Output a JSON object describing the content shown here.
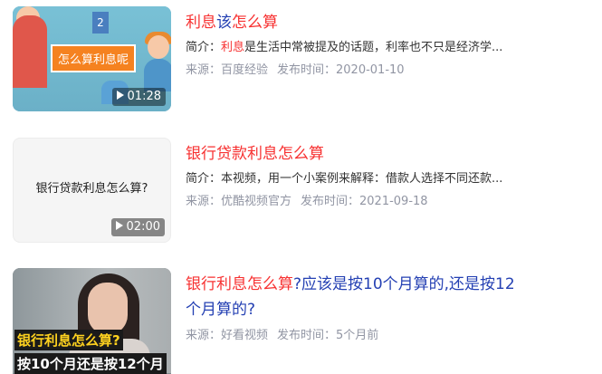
{
  "results": [
    {
      "thumb_sign": "怎么算利息呢",
      "thumb_flag": "2",
      "duration": "01:28",
      "title_parts": [
        {
          "text": "利息",
          "hl": true
        },
        {
          "text": "该",
          "hl": false
        },
        {
          "text": "怎么算",
          "hl": true
        }
      ],
      "desc_prefix": "简介：",
      "desc_hl": "利息",
      "desc_rest": "是生活中常被提及的话题，利率也不只是经济学...",
      "source": "来源：百度经验",
      "publish": "发布时间：2020-01-10"
    },
    {
      "thumb_text": "银行贷款利息怎么算?",
      "duration": "02:00",
      "title_parts": [
        {
          "text": "银行贷款",
          "hl": true
        },
        {
          "text": "利息怎么算",
          "hl": true
        }
      ],
      "desc_prefix": "简介：",
      "desc_hl": "",
      "desc_rest": "本视频，用一个小案例来解释：借款人选择不同还款...",
      "source": "来源：优酷视频官方",
      "publish": "发布时间：2021-09-18"
    },
    {
      "thumb_caption1": "银行利息怎么算?",
      "thumb_caption2": "按10个月还是按12个月",
      "title_parts": [
        {
          "text": "银行利息怎么算",
          "hl": true
        },
        {
          "text": "?应该是按10个月算的,还是按12个月算的?",
          "hl": false
        }
      ],
      "desc_prefix": "",
      "desc_hl": "",
      "desc_rest": "",
      "source": "来源：好看视频",
      "publish": "发布时间：5个月前"
    }
  ],
  "colors": {
    "link": "#2440b3",
    "highlight": "#f73131",
    "meta": "#9195a3"
  }
}
